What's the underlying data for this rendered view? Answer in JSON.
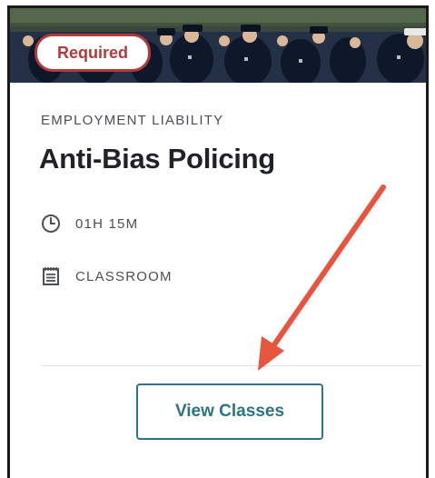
{
  "card": {
    "badge": "Required",
    "category": "EMPLOYMENT LIABILITY",
    "title": "Anti-Bias Policing",
    "duration": "01H 15M",
    "format": "CLASSROOM",
    "button_label": "View Classes"
  },
  "icons": {
    "duration": "clock-icon",
    "format": "notepad-icon"
  },
  "colors": {
    "badge": "#b23a3a",
    "button": "#2e7385",
    "arrow": "#e8553f",
    "text": "#1f2328",
    "muted": "#4a4f55"
  }
}
